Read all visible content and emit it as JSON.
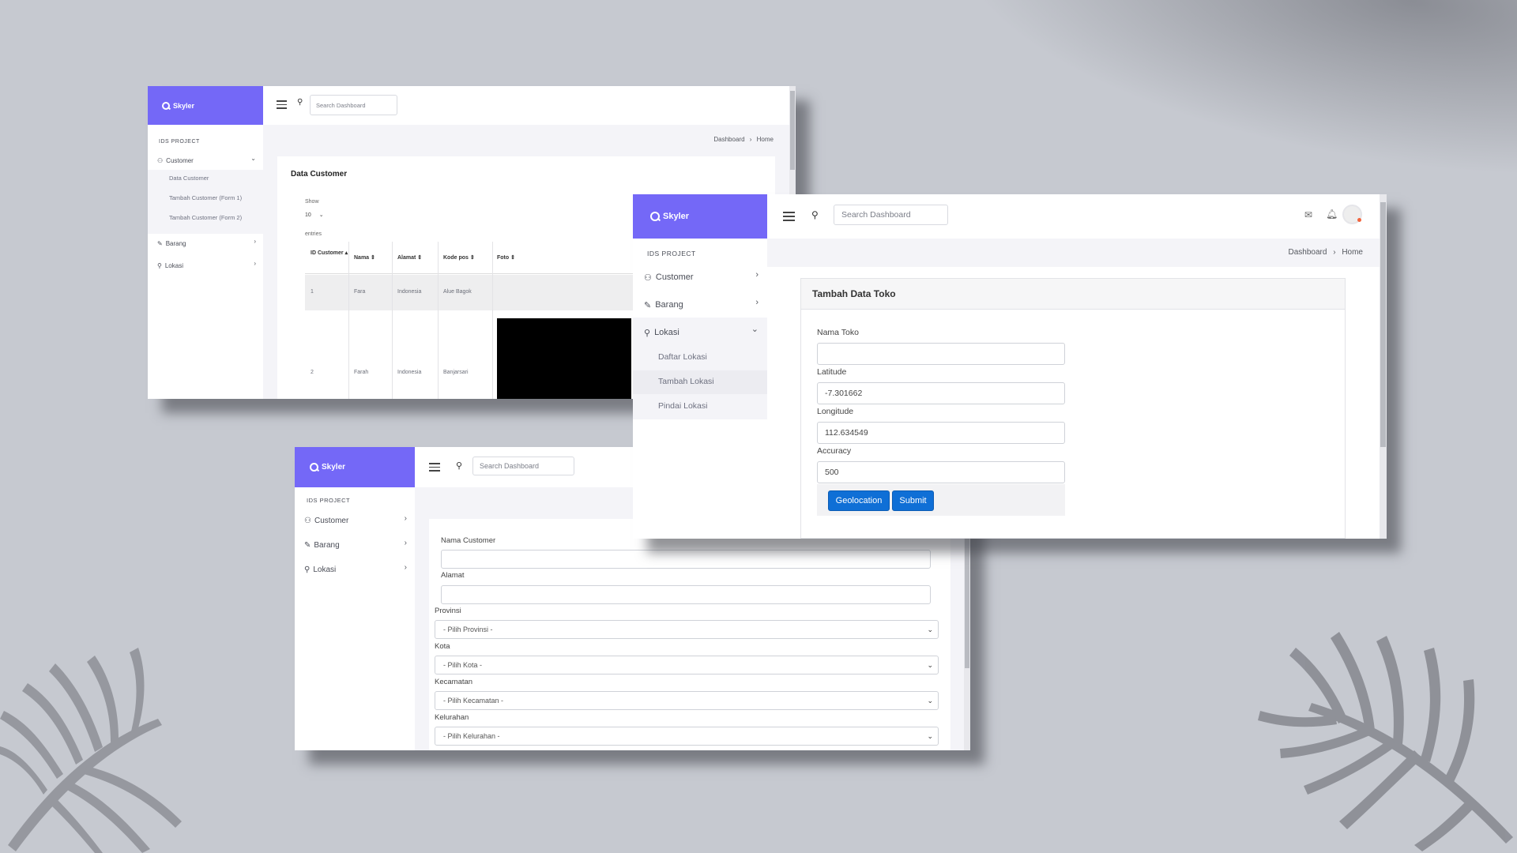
{
  "brand": "Skyler",
  "section_label": "IDS PROJECT",
  "search_placeholder": "Search Dashboard",
  "breadcrumb": {
    "parent": "Dashboard",
    "current": "Home"
  },
  "nav": {
    "customer": "Customer",
    "barang": "Barang",
    "lokasi": "Lokasi"
  },
  "customer_sub": {
    "data_customer": "Data Customer",
    "tambah_form1": "Tambah Customer (Form 1)",
    "tambah_form2": "Tambah Customer (Form 2)"
  },
  "lokasi_sub": {
    "daftar": "Daftar Lokasi",
    "tambah": "Tambah Lokasi",
    "pindai": "Pindai Lokasi"
  },
  "data_customer": {
    "title": "Data Customer",
    "show": "Show",
    "entries_value": "10",
    "entries": "entries",
    "headers": {
      "id": "ID Customer",
      "nama": "Nama",
      "alamat": "Alamat",
      "kodepos": "Kode pos",
      "foto": "Foto"
    },
    "rows": [
      {
        "id": "1",
        "nama": "Fara",
        "alamat": "Indonesia",
        "kodepos": "Alue Bagok"
      },
      {
        "id": "2",
        "nama": "Farah",
        "alamat": "Indonesia",
        "kodepos": "Banjarsari"
      }
    ]
  },
  "tambah_toko": {
    "title": "Tambah Data Toko",
    "nama_label": "Nama Toko",
    "nama_value": "",
    "lat_label": "Latitude",
    "lat_value": "-7.301662",
    "lng_label": "Longitude",
    "lng_value": "112.634549",
    "acc_label": "Accuracy",
    "acc_value": "500",
    "geo_button": "Geolocation",
    "submit_button": "Submit"
  },
  "form_customer": {
    "nama_label": "Nama Customer",
    "alamat_label": "Alamat",
    "provinsi_label": "Provinsi",
    "provinsi_value": "- Pilih Provinsi -",
    "kota_label": "Kota",
    "kota_value": "- Pilih Kota -",
    "kecamatan_label": "Kecamatan",
    "kecamatan_value": "- Pilih Kecamatan -",
    "kelurahan_label": "Kelurahan",
    "kelurahan_value": "- Pilih Kelurahan -"
  },
  "colors": {
    "brand": "#7468f7",
    "button": "#0f6fd6",
    "background": "#c6c9d0"
  }
}
